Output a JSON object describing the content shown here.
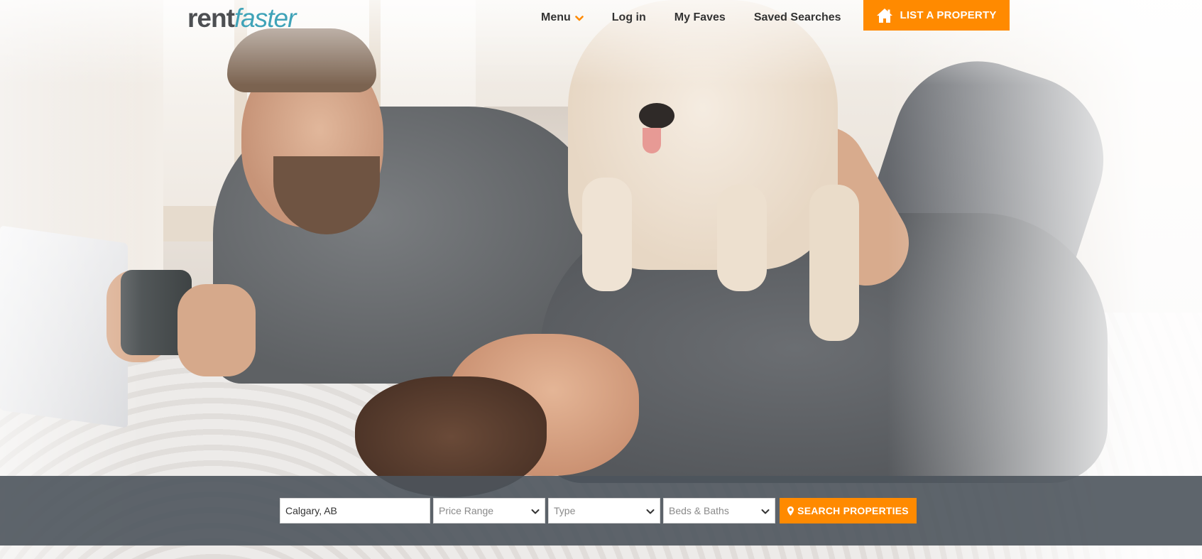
{
  "brand": {
    "logo_part1": "rent",
    "logo_part2": "faster",
    "primary_color": "#3fa3b8",
    "accent_color": "#ff8a00"
  },
  "nav": {
    "items": [
      {
        "label": "Menu",
        "icon": "chevron-down-icon"
      },
      {
        "label": "Log in"
      },
      {
        "label": "My Faves"
      },
      {
        "label": "Saved Searches"
      }
    ],
    "list_property": {
      "label": "LIST A PROPERTY",
      "icon": "house-icon"
    }
  },
  "hero": {
    "image": "photo-two-men-with-puppy-on-bed"
  },
  "search": {
    "location_value": "Calgary, AB",
    "price_range": "Price Range",
    "type": "Type",
    "beds_baths": "Beds & Baths",
    "button_label": "SEARCH PROPERTIES",
    "button_icon": "map-pin-icon"
  }
}
